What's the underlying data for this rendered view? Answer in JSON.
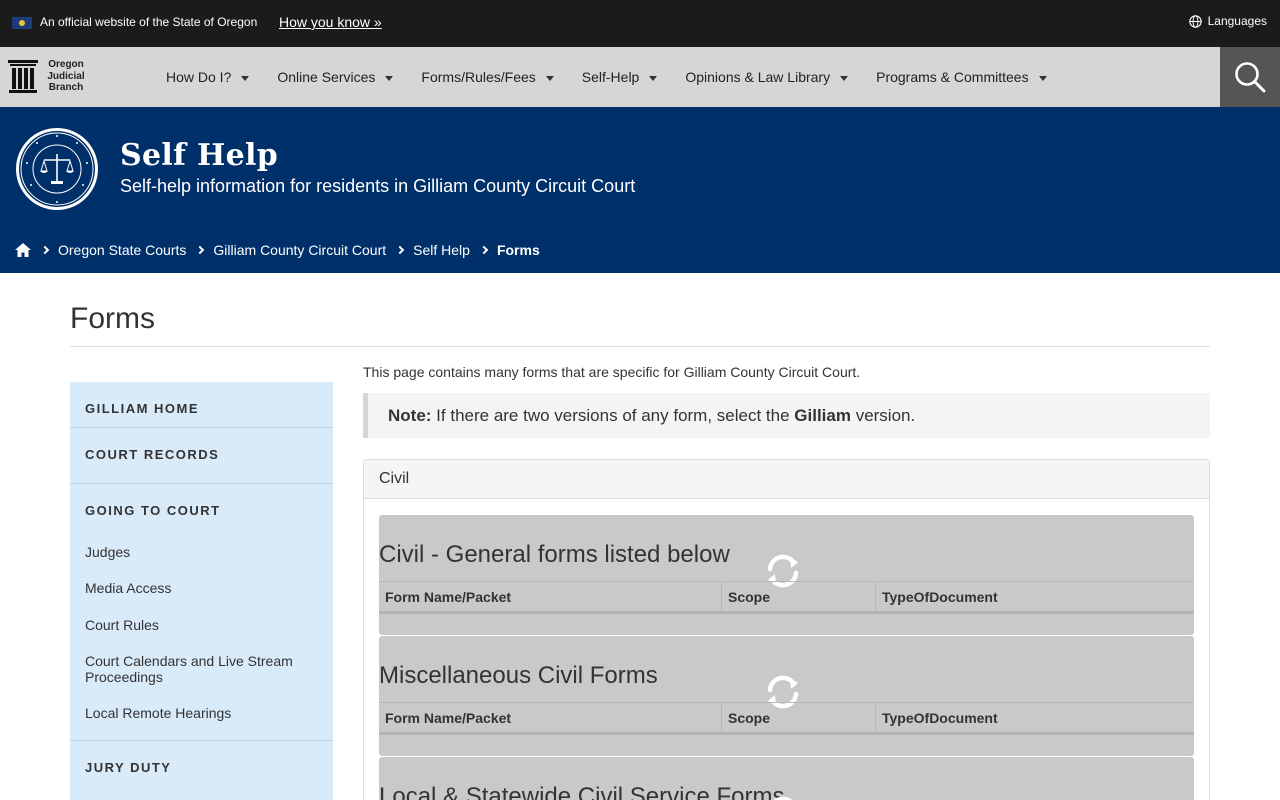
{
  "official_banner": {
    "text": "An official website of the State of Oregon",
    "how_you_know": "How you know »",
    "languages": "Languages"
  },
  "logo": {
    "line1": "Oregon",
    "line2": "Judicial",
    "line3": "Branch"
  },
  "nav": {
    "items": [
      {
        "label": "How Do I?"
      },
      {
        "label": "Online Services"
      },
      {
        "label": "Forms/Rules/Fees"
      },
      {
        "label": "Self-Help"
      },
      {
        "label": "Opinions & Law Library"
      },
      {
        "label": "Programs & Committees"
      }
    ]
  },
  "hero": {
    "title": "Self Help",
    "subtitle": "Self-help information for residents in Gilliam County Circuit Court"
  },
  "breadcrumb": {
    "items": [
      "Oregon State Courts",
      "Gilliam County Circuit Court",
      "Self Help"
    ],
    "current": "Forms"
  },
  "page": {
    "title": "Forms",
    "intro": "This page contains many forms that are specific for Gilliam County Circuit Court.",
    "note_label": "Note:",
    "note_text_1": " If there are two versions of any form, select the ",
    "note_bold": "Gilliam",
    "note_text_2": " version."
  },
  "sidebar": {
    "home": "GILLIAM HOME",
    "records": "COURT RECORDS",
    "going": "GOING TO COURT",
    "links": [
      "Judges",
      "Media Access",
      "Court Rules",
      "Court Calendars and Live Stream Proceedings",
      "Local Remote Hearings"
    ],
    "jury": "JURY DUTY"
  },
  "panel": {
    "heading": "Civil",
    "blocks": [
      {
        "title": "Civil - General forms listed below"
      },
      {
        "title": "Miscellaneous Civil Forms"
      },
      {
        "title": "Local & Statewide Civil Service Forms"
      }
    ],
    "columns": [
      "Form Name/Packet",
      "Scope",
      "TypeOfDocument"
    ]
  }
}
